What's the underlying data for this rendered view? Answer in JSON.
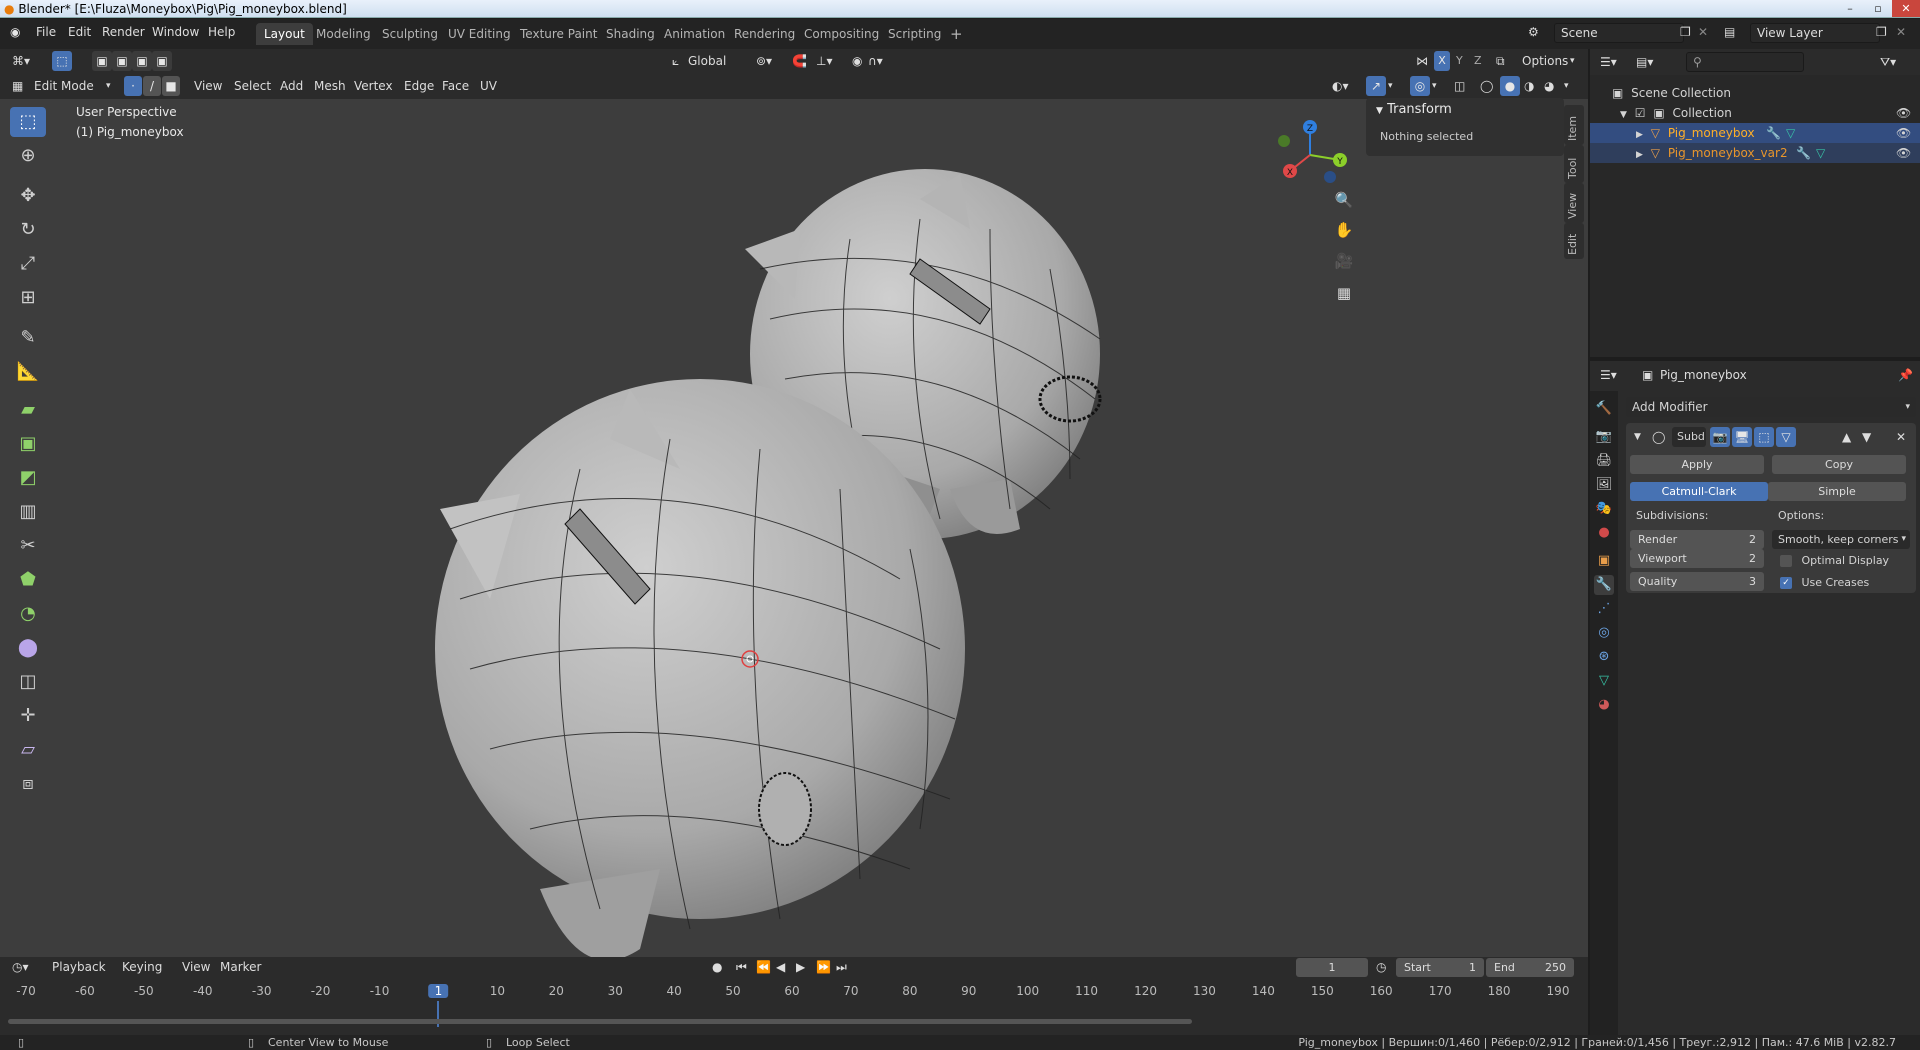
{
  "window": {
    "title": "Blender* [E:\\Fluza\\Moneybox\\Pig\\Pig_moneybox.blend]"
  },
  "menu": [
    "File",
    "Edit",
    "Render",
    "Window",
    "Help"
  ],
  "workspaces": [
    {
      "label": "Layout",
      "active": true
    },
    {
      "label": "Modeling"
    },
    {
      "label": "Sculpting"
    },
    {
      "label": "UV Editing"
    },
    {
      "label": "Texture Paint"
    },
    {
      "label": "Shading"
    },
    {
      "label": "Animation"
    },
    {
      "label": "Rendering"
    },
    {
      "label": "Compositing"
    },
    {
      "label": "Scripting"
    }
  ],
  "scene": {
    "name": "Scene",
    "view_layer": "View Layer"
  },
  "viewport": {
    "orientation": "Global",
    "options_label": "Options",
    "mode": "Edit Mode",
    "menus": [
      "View",
      "Select",
      "Add",
      "Mesh",
      "Vertex",
      "Edge",
      "Face",
      "UV"
    ],
    "overlay_line1": "User Perspective",
    "overlay_line2": "(1) Pig_moneybox",
    "gizmo_axes": {
      "x": "X",
      "y": "Y",
      "z": "Z"
    },
    "axis_toggles": [
      "X",
      "Y",
      "Z"
    ],
    "npanel": {
      "header": "Transform",
      "text": "Nothing selected"
    },
    "side_tabs": [
      "Item",
      "Tool",
      "View",
      "Edit"
    ]
  },
  "outliner": {
    "root": "Scene Collection",
    "collection": "Collection",
    "objects": [
      "Pig_moneybox",
      "Pig_moneybox_var2"
    ]
  },
  "properties": {
    "object_name": "Pig_moneybox",
    "add_modifier": "Add Modifier",
    "modifier_name": "Subd",
    "apply": "Apply",
    "copy": "Copy",
    "type_options": [
      "Catmull-Clark",
      "Simple"
    ],
    "subdivisions_label": "Subdivisions:",
    "options_label": "Options:",
    "fields": [
      {
        "label": "Render",
        "value": "2"
      },
      {
        "label": "Viewport",
        "value": "2"
      },
      {
        "label": "Quality",
        "value": "3"
      }
    ],
    "uv_smooth": "Smooth, keep corners",
    "optimal_display": "Optimal Display",
    "use_creases": "Use Creases"
  },
  "timeline": {
    "menus": [
      "Playback",
      "Keying",
      "View",
      "Marker"
    ],
    "current_frame": "1",
    "start_label": "Start",
    "start": "1",
    "end_label": "End",
    "end": "250",
    "ticks": [
      "-70",
      "-60",
      "-50",
      "-40",
      "-30",
      "-20",
      "-10",
      "1",
      "10",
      "20",
      "30",
      "40",
      "50",
      "60",
      "70",
      "80",
      "90",
      "100",
      "110",
      "120",
      "130",
      "140",
      "150",
      "160",
      "170",
      "180",
      "190"
    ],
    "highlight": "1"
  },
  "status": {
    "left_hint": "Center View to Mouse",
    "mid_hint": "Loop Select",
    "stats": "Pig_moneybox | Вершин:0/1,460 | Рёбер:0/2,912 | Граней:0/1,456 | Треуг.:2,912 | Пам.: 47.6 MiB | v2.82.7"
  },
  "icons": [
    "blender-logo-icon",
    "select-box-icon",
    "cursor-icon",
    "move-icon",
    "rotate-icon",
    "scale-icon",
    "transform-icon",
    "annotate-icon",
    "measure-icon",
    "extrude-icon",
    "inset-icon",
    "bevel-icon",
    "loop-cut-icon",
    "knife-icon",
    "poly-build-icon",
    "spin-icon",
    "smooth-icon",
    "edge-slide-icon",
    "shrink-fatten-icon",
    "shear-icon",
    "rip-icon",
    "zoom-icon",
    "hand-icon",
    "camera-icon",
    "grid-icon",
    "eye-icon",
    "wrench-icon",
    "filter-icon",
    "search-icon"
  ]
}
